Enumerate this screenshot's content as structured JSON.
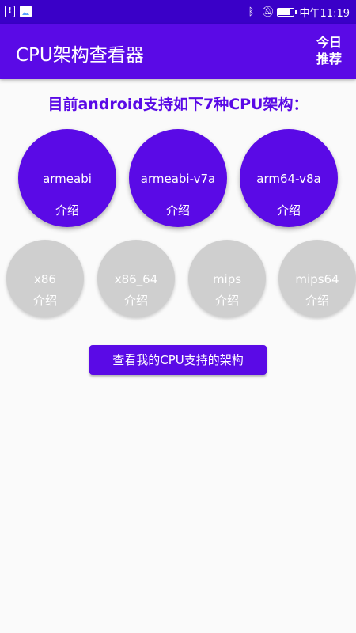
{
  "status_bar": {
    "time": "中午11:19",
    "icons": [
      "alert-notification-icon",
      "image-notification-icon",
      "bluetooth-icon",
      "mute-icon",
      "battery-icon"
    ]
  },
  "app_bar": {
    "title": "CPU架构查看器",
    "action_label": "今日推荐"
  },
  "headline": "目前android支持如下7种CPU架构：",
  "primary_arches": [
    {
      "name": "armeabi",
      "intro": "介绍"
    },
    {
      "name": "armeabi-v7a",
      "intro": "介绍"
    },
    {
      "name": "arm64-v8a",
      "intro": "介绍"
    }
  ],
  "secondary_arches": [
    {
      "name": "x86",
      "intro": "介绍"
    },
    {
      "name": "x86_64",
      "intro": "介绍"
    },
    {
      "name": "mips",
      "intro": "介绍"
    },
    {
      "name": "mips64",
      "intro": "介绍"
    }
  ],
  "check_button_label": "查看我的CPU支持的架构",
  "colors": {
    "status_bar": "#3a00c8",
    "primary": "#5a0ae6",
    "disabled_circle": "#cfcfcf",
    "background": "#fafafa"
  }
}
